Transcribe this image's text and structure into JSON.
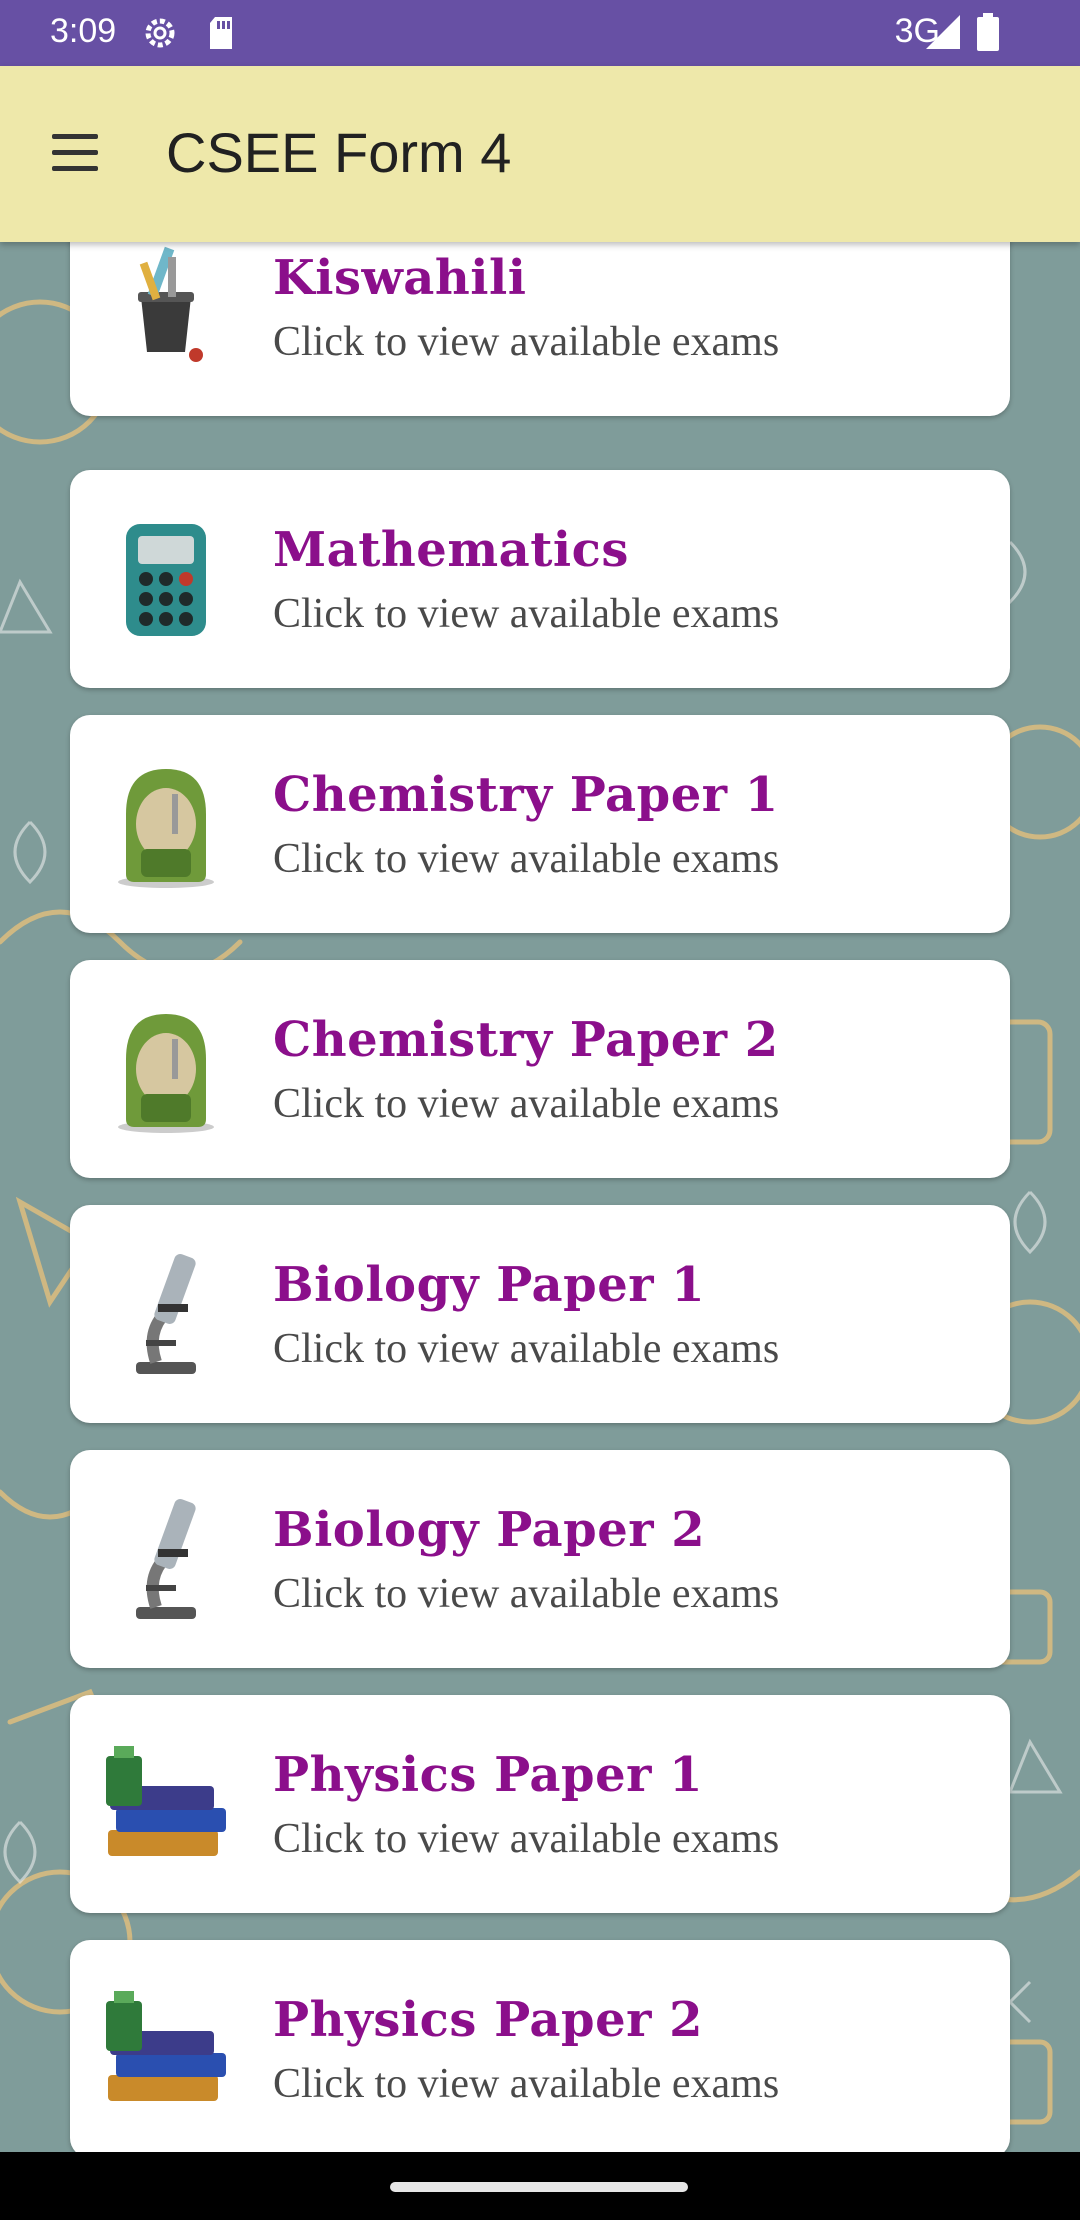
{
  "status_bar": {
    "time": "3:09",
    "network": "3G",
    "icons": [
      "settings-icon",
      "sd-card-icon",
      "signal-icon",
      "battery-icon"
    ]
  },
  "app_bar": {
    "title": "CSEE Form 4",
    "icon": "hamburger-menu-icon",
    "background": "#eee8aa"
  },
  "subjects": [
    {
      "name": "Kiswahili",
      "subtitle": "Click to view available exams",
      "icon": "pencil-cup-icon"
    },
    {
      "name": "Mathematics",
      "subtitle": "Click to view available exams",
      "icon": "calculator-icon"
    },
    {
      "name": "Chemistry Paper 1",
      "subtitle": "Click to view available exams",
      "icon": "backpack-icon"
    },
    {
      "name": "Chemistry Paper 2",
      "subtitle": "Click to view available exams",
      "icon": "backpack-icon"
    },
    {
      "name": "Biology Paper 1",
      "subtitle": "Click to view available exams",
      "icon": "microscope-icon"
    },
    {
      "name": "Biology Paper 2",
      "subtitle": "Click to view available exams",
      "icon": "microscope-icon"
    },
    {
      "name": "Physics Paper 1",
      "subtitle": "Click to view available exams",
      "icon": "books-icon"
    },
    {
      "name": "Physics Paper 2",
      "subtitle": "Click to view available exams",
      "icon": "books-icon"
    }
  ],
  "colors": {
    "status_bar": "#6750a4",
    "subject_title": "#8b0f8b",
    "background": "#7f9c9a"
  }
}
